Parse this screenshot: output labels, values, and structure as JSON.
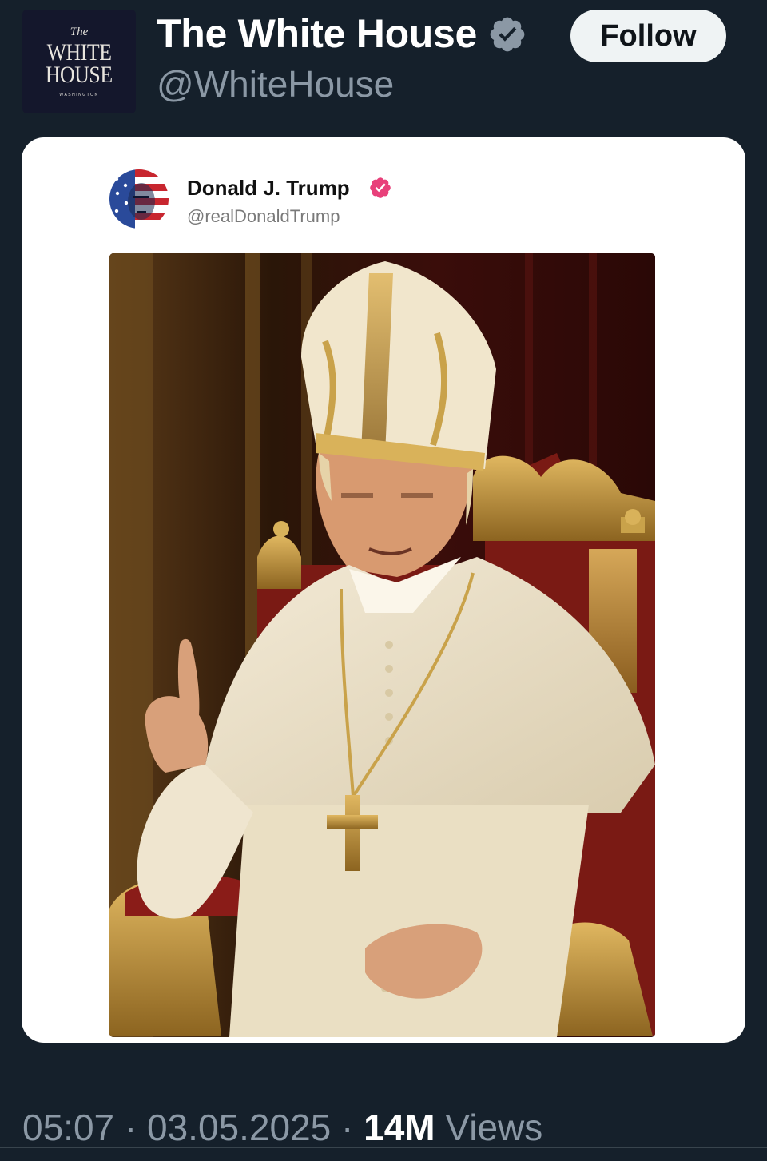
{
  "header": {
    "avatar": {
      "line_the": "The",
      "line_white": "WHITE",
      "line_house": "HOUSE",
      "line_sub": "WASHINGTON"
    },
    "display_name": "The White House",
    "handle": "@WhiteHouse",
    "follow_label": "Follow",
    "verified_badge_color": "#8b98a5"
  },
  "embedded_post": {
    "author_name": "Donald J. Trump",
    "author_handle": "@realDonaldTrump",
    "verified_badge_color": "#e8407a",
    "image_icon": "photo"
  },
  "footer": {
    "time": "05:07",
    "separator": "·",
    "date": "03.05.2025",
    "views_count": "14M",
    "views_label": "Views"
  },
  "colors": {
    "background": "#15202b",
    "text_primary": "#ffffff",
    "text_secondary": "#8b98a5",
    "button_bg": "#eff3f4"
  }
}
